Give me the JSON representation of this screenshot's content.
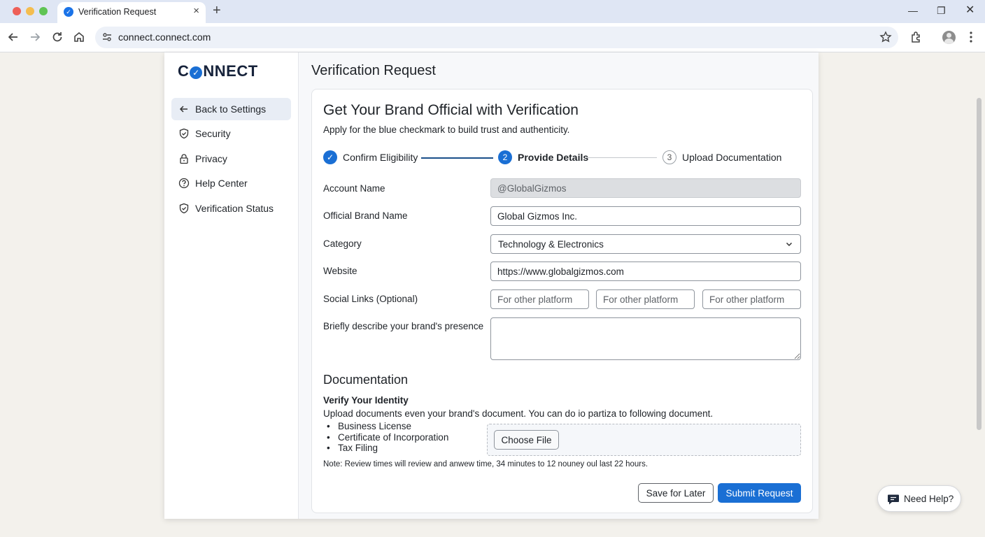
{
  "browser": {
    "tab_title": "Verification Request",
    "url": "connect.connect.com"
  },
  "brand": {
    "logo_prefix": "C",
    "logo_check": "✓",
    "logo_suffix": "NNECT",
    "accent_color": "#1a6fd4"
  },
  "sidebar": {
    "items": [
      {
        "label": "Back to Settings",
        "icon": "arrow-left-icon"
      },
      {
        "label": "Security",
        "icon": "shield-check-icon"
      },
      {
        "label": "Privacy",
        "icon": "lock-icon"
      },
      {
        "label": "Help Center",
        "icon": "question-circle-icon"
      },
      {
        "label": "Verification Status",
        "icon": "shield-check-icon"
      }
    ]
  },
  "main": {
    "page_title": "Verification Request",
    "card_title": "Get Your Brand Official with Verification",
    "card_subtitle": "Apply for the blue checkmark to build trust and authenticity.",
    "steps": [
      {
        "number": "✓",
        "label": "Confirm Eligibility",
        "state": "done"
      },
      {
        "number": "2",
        "label": "Provide Details",
        "state": "active"
      },
      {
        "number": "3",
        "label": "Upload Documentation",
        "state": "todo"
      }
    ],
    "form": {
      "account_name_label": "Account Name",
      "account_name_placeholder": "@GlobalGizmos",
      "brand_name_label": "Official Brand Name",
      "brand_name_value": "Global Gizmos Inc.",
      "category_label": "Category",
      "category_value": "Technology & Electronics",
      "website_label": "Website",
      "website_value": "https://www.globalgizmos.com",
      "social_label": "Social Links (Optional)",
      "social_placeholder": "For other platform",
      "presence_label": "Briefly describe your brand's presence"
    },
    "documentation": {
      "title": "Documentation",
      "subtitle": "Verify Your Identity",
      "description": "Upload documents even your brand's document. You can do io partiza to  following document.",
      "list": [
        "Business License",
        "Certificate of Incorporation",
        "Tax Filing"
      ],
      "choose_file_label": "Choose File",
      "note": "Note: Review times will review and anwew time, 34 minutes to 12 nouney oul last 22 hours."
    },
    "actions": {
      "save_label": "Save for Later",
      "submit_label": "Submit Request"
    }
  },
  "help": {
    "label": "Need Help?"
  }
}
